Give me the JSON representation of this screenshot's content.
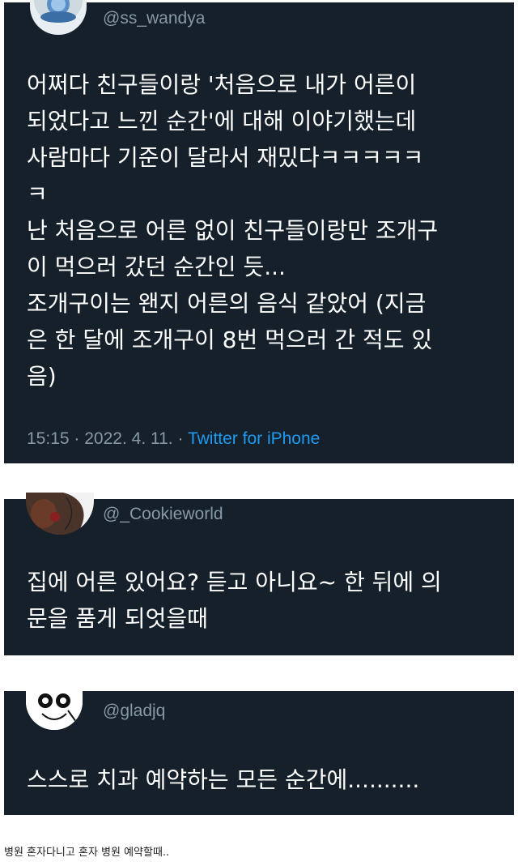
{
  "tweets": [
    {
      "handle": "@ss_wandya",
      "text": "어쩌다 친구들이랑 '처음으로 내가 어른이\n되었다고 느낀 순간'에 대해 이야기했는데\n사람마다 기준이 달라서 재밌다ㅋㅋㅋㅋㅋ\nㅋ\n난 처음으로 어른 없이 친구들이랑만 조개구\n이 먹으러 갔던 순간인 듯...\n조개구이는 왠지 어른의 음식 같았어 (지금\n은 한 달에 조개구이 8번 먹으러 간 적도 있\n음)",
      "time": "15:15",
      "date": "2022. 4. 11.",
      "separator": "·",
      "source": "Twitter for iPhone"
    },
    {
      "handle": "@_Cookieworld",
      "text": "집에 어른 있어요? 듣고 아니요~ 한 뒤에 의\n문을 품게 되엇을때"
    },
    {
      "handle": "@gladjq",
      "text": "스스로 치과 예약하는 모든 순간에.........."
    }
  ],
  "caption": "병원 혼자다니고 혼자 병원 예약할때..",
  "colors": {
    "card_bg": "#15202b",
    "text": "#ffffff",
    "muted": "#8899a6",
    "link": "#1d9bf0"
  }
}
